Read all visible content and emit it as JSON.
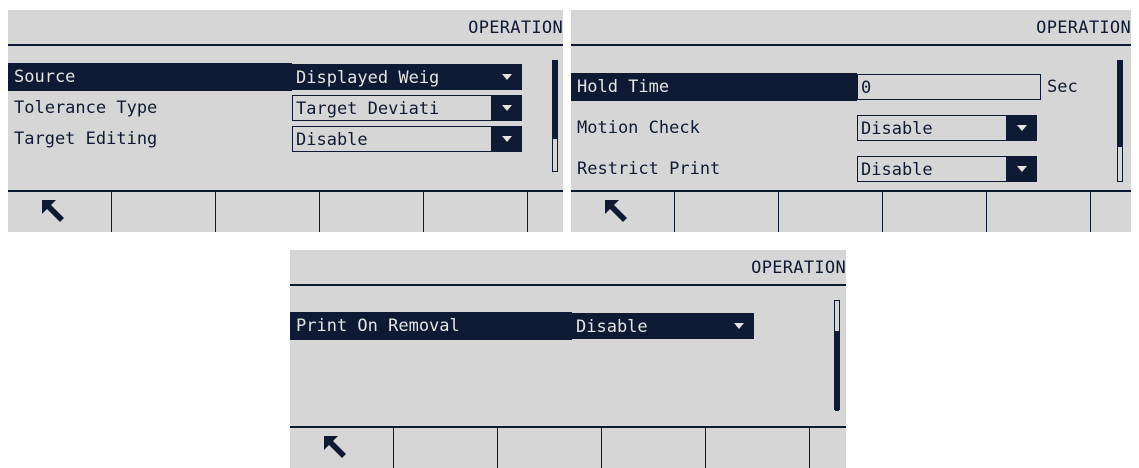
{
  "screens": [
    {
      "title": "OPERATION",
      "rows": [
        {
          "label": "Source",
          "value": "Displayed Weig",
          "selected": true
        },
        {
          "label": "Tolerance Type",
          "value": "Target Deviati",
          "selected": false
        },
        {
          "label": "Target Editing",
          "value": "Disable",
          "selected": false
        }
      ]
    },
    {
      "title": "OPERATION",
      "rows": [
        {
          "label": "Hold Time",
          "value": "0",
          "unit": "Sec",
          "selected": true
        },
        {
          "label": "Motion Check",
          "value": "Disable",
          "selected": false
        },
        {
          "label": "Restrict Print",
          "value": "Disable",
          "selected": false
        }
      ]
    },
    {
      "title": "OPERATION",
      "rows": [
        {
          "label": "Print On Removal",
          "value": "Disable",
          "selected": true
        }
      ]
    }
  ],
  "icons": {
    "softkey_1": "escape-up-left-arrow-icon",
    "dropdown": "caret-down-icon"
  },
  "colors": {
    "background": "#d6d6d6",
    "foreground": "#0e1a33"
  }
}
